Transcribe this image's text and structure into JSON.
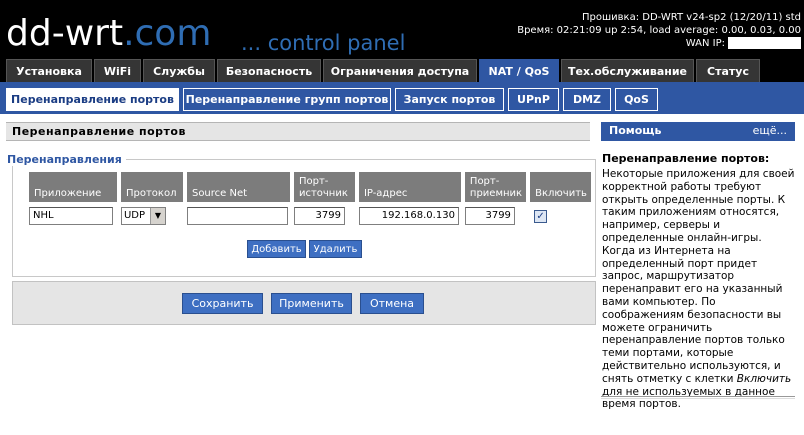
{
  "header": {
    "logo_main": "dd-wrt",
    "logo_suffix": ".com",
    "tagline": "... control panel",
    "firmware": "Прошивка: DD-WRT v24-sp2 (12/20/11) std",
    "time": "Время: 02:21:09 up 2:54, load average: 0.00, 0.03, 0.00",
    "wan_ip_label": "WAN IP:"
  },
  "main_tabs": [
    {
      "label": "Установка"
    },
    {
      "label": "WiFi"
    },
    {
      "label": "Службы"
    },
    {
      "label": "Безопасность"
    },
    {
      "label": "Ограничения доступа"
    },
    {
      "label": "NAT / QoS"
    },
    {
      "label": "Тех.обслуживание"
    },
    {
      "label": "Статус"
    }
  ],
  "sub_tabs": [
    {
      "label": "Перенаправление портов"
    },
    {
      "label": "Перенаправление групп портов"
    },
    {
      "label": "Запуск портов"
    },
    {
      "label": "UPnP"
    },
    {
      "label": "DMZ"
    },
    {
      "label": "QoS"
    }
  ],
  "section_title": "Перенаправление портов",
  "fieldset_legend": "Перенаправления",
  "table": {
    "headers": {
      "app": "Приложение",
      "proto": "Протокол",
      "source_net": "Source Net",
      "port_from_1": "Порт-",
      "port_from_2": "источник",
      "ip": "IP-адрес",
      "port_to_1": "Порт-",
      "port_to_2": "приемник",
      "enable": "Включить"
    },
    "rows": [
      {
        "app": "NHL",
        "proto": "UDP",
        "source_net": "",
        "port_from": "3799",
        "ip": "192.168.0.130",
        "port_to": "3799",
        "enabled": "✓"
      }
    ]
  },
  "buttons": {
    "add": "Добавить",
    "remove": "Удалить",
    "save": "Сохранить",
    "apply": "Применить",
    "cancel": "Отмена"
  },
  "help": {
    "header": "Помощь",
    "more": "ещё...",
    "title": "Перенаправление портов:",
    "text_before": "Некоторые приложения для своей корректной работы требуют открыть определенные порты. К таким приложениям относятся, например, серверы и определенные онлайн-игры. Когда из Интернета на определенный порт придет запрос, маршрутизатор перенаправит его на указанный вами компьютер. По соображениям безопасности вы можете ограничить перенаправление портов только теми портами, которые действительно используются, и снять отметку с клетки ",
    "text_em": "Включить",
    "text_after": " для не используемых в данное время портов."
  },
  "colors": {
    "accent": "#2f57a3",
    "button": "#3e6fc2",
    "tab_bg": "#353535",
    "header_bg": "#000000"
  }
}
